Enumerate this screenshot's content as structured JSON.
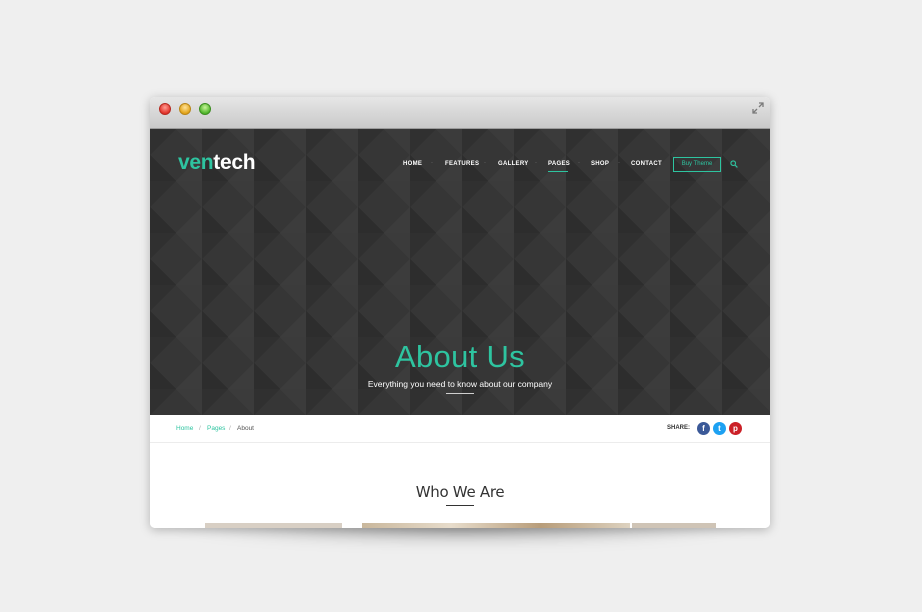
{
  "brand": {
    "part1": "ven",
    "part2": "tech"
  },
  "nav": {
    "items": [
      "HOME",
      "FEATURES",
      "GALLERY",
      "PAGES",
      "SHOP",
      "CONTACT"
    ],
    "active": "PAGES",
    "separator": "·",
    "buy_label": "Buy Theme"
  },
  "hero": {
    "title": "About Us",
    "subtitle": "Everything you need to know about our company"
  },
  "breadcrumb": {
    "home": "Home",
    "pages": "Pages",
    "current": "About",
    "separator": "/"
  },
  "share": {
    "label": "SHARE:",
    "networks": [
      {
        "name": "facebook-icon",
        "glyph": "f",
        "color": "#3b5998"
      },
      {
        "name": "twitter-icon",
        "glyph": "t",
        "color": "#1da1f2"
      },
      {
        "name": "pinterest-icon",
        "glyph": "p",
        "color": "#cb2027"
      }
    ]
  },
  "section": {
    "title": "Who We Are"
  },
  "colors": {
    "accent": "#2ec4a0",
    "hero_bg": "#363636"
  }
}
